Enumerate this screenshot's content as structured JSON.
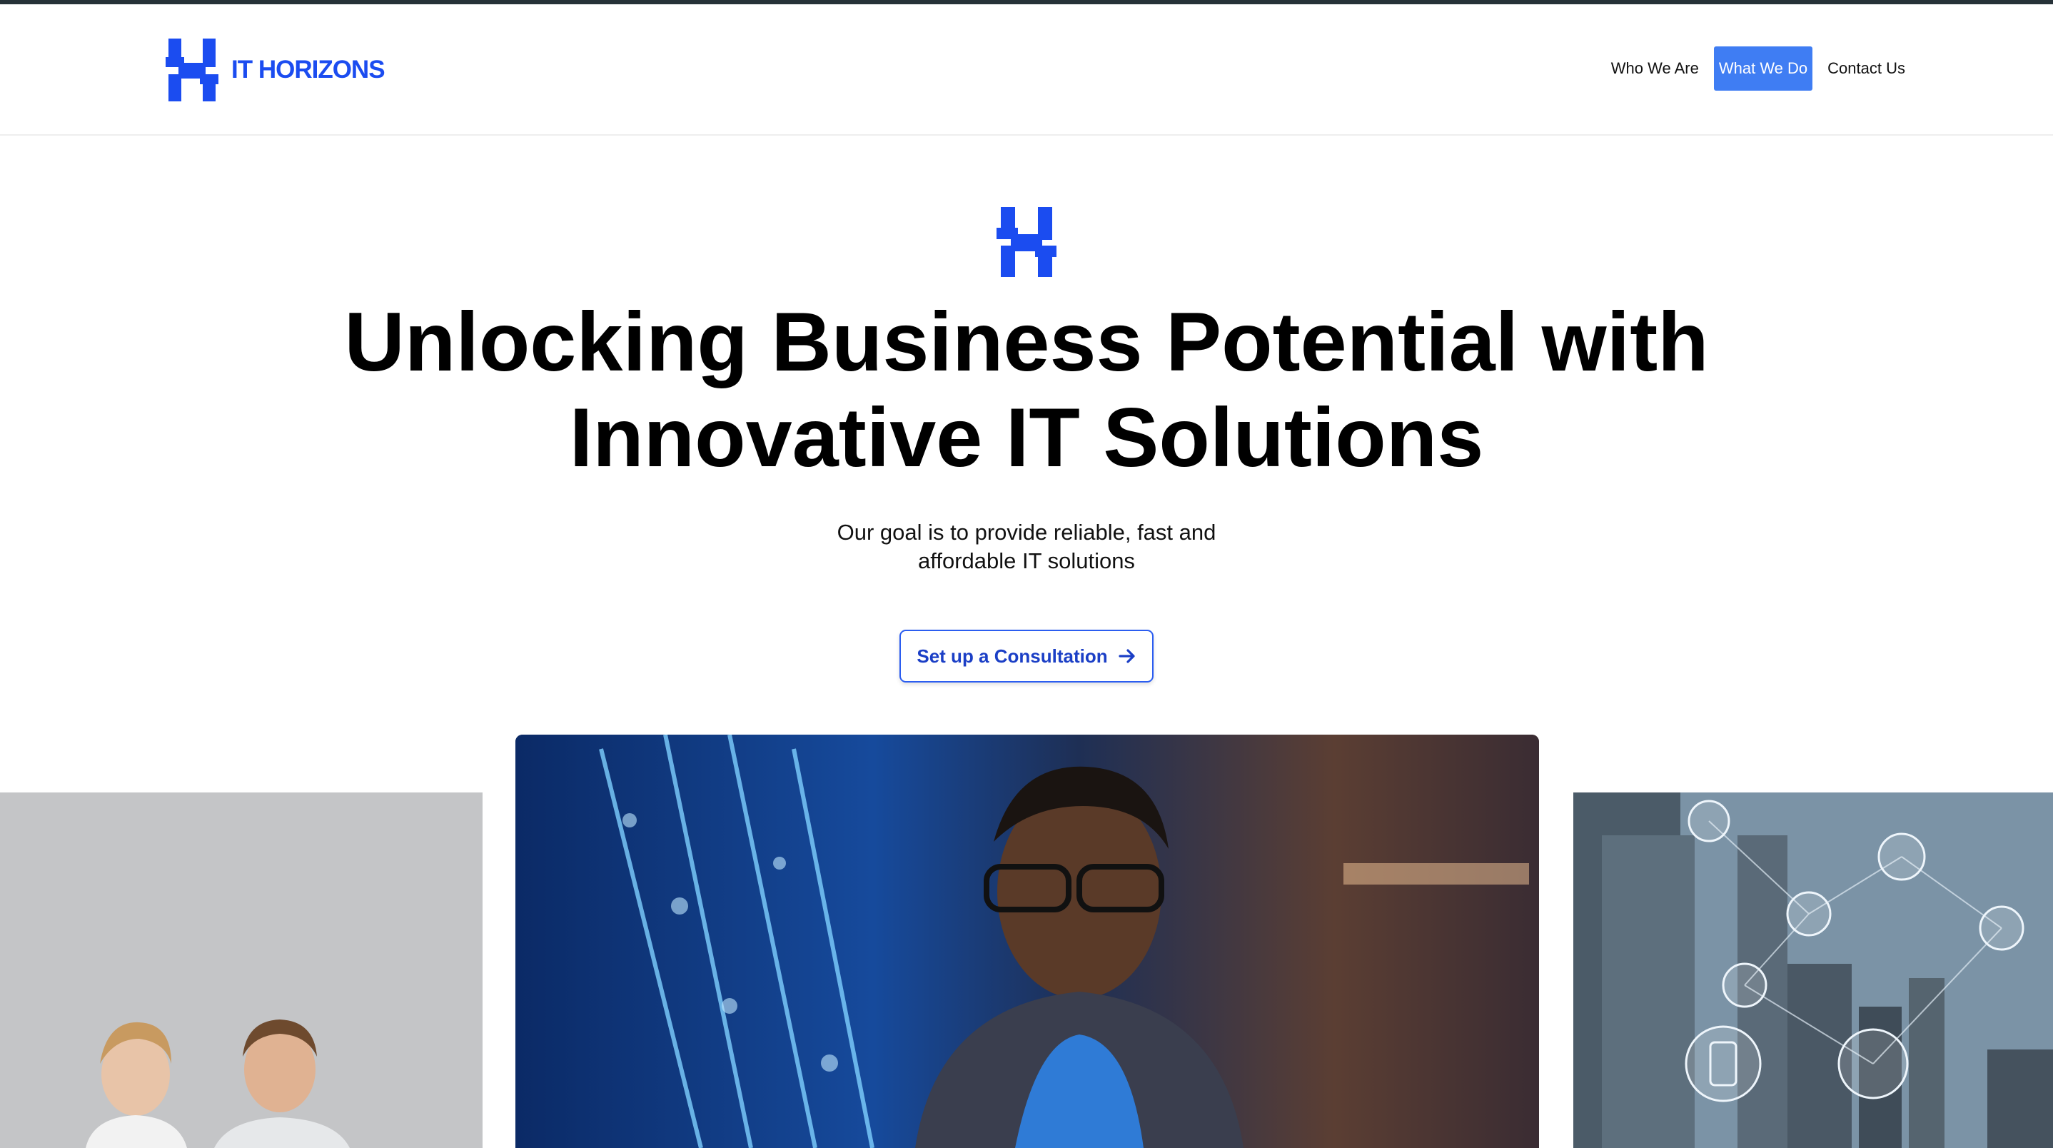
{
  "brand": {
    "name": "IT HORIZONS",
    "color": "#1b4cf0"
  },
  "nav": {
    "items": [
      {
        "label": "Who We Are",
        "active": false
      },
      {
        "label": "What We Do",
        "active": true
      },
      {
        "label": "Contact Us",
        "active": false
      }
    ],
    "active_color": "#3f7df3"
  },
  "hero": {
    "title": "Unlocking Business Potential with Innovative IT Solutions",
    "subtitle": "Our goal is to provide reliable, fast and affordable IT solutions",
    "cta_label": "Set up a Consultation",
    "cta_icon": "arrow-right-icon"
  },
  "photos": [
    {
      "name": "team-photo",
      "icon": "image"
    },
    {
      "name": "engineer-server-room-photo",
      "icon": "image"
    },
    {
      "name": "city-network-photo",
      "icon": "image"
    }
  ]
}
